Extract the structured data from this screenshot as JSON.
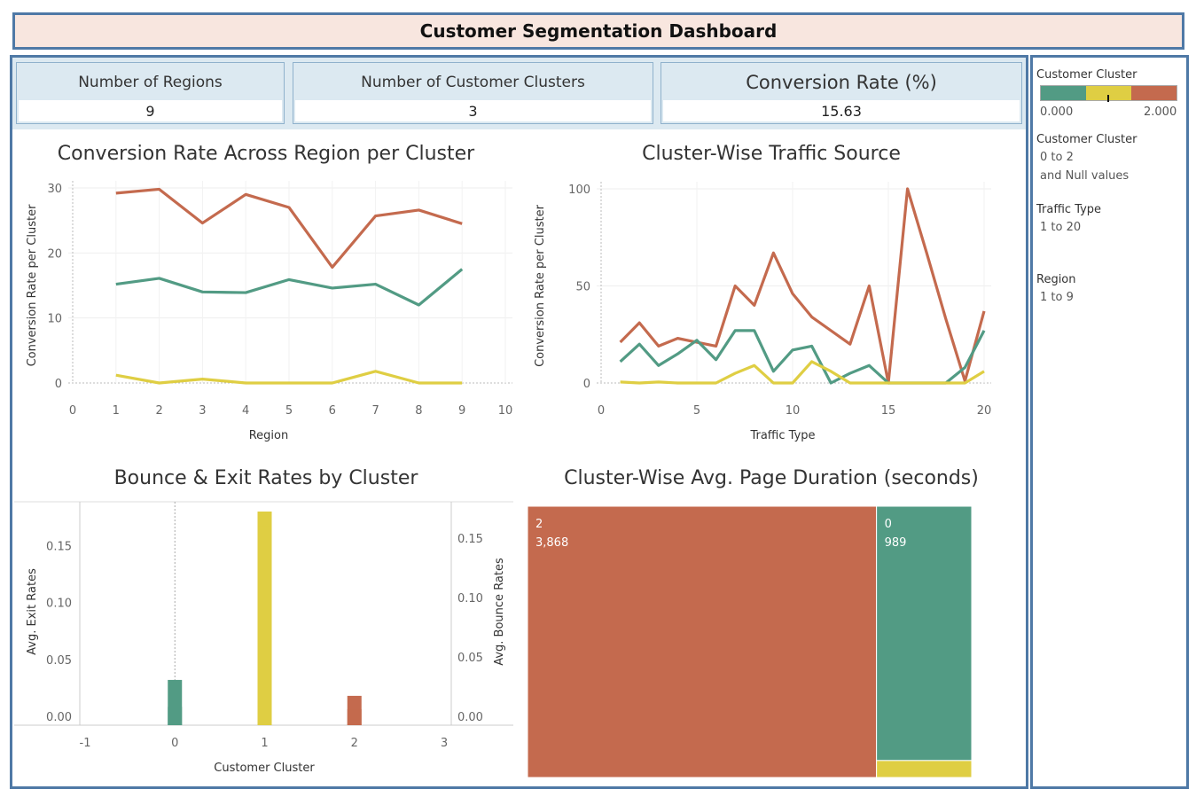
{
  "title": "Customer Segmentation  Dashboard",
  "kpis": [
    {
      "label": "Number of Regions",
      "value": "9"
    },
    {
      "label": "Number of Customer Clusters",
      "value": "3"
    },
    {
      "label": "Conversion Rate (%)",
      "value": "15.63"
    }
  ],
  "colors": {
    "cluster0": "#529b84",
    "cluster1": "#dfce43",
    "cluster2": "#c46a4e"
  },
  "sidebar": {
    "color_legend_title": "Customer Cluster",
    "color_min": "0.000",
    "color_max": "2.000",
    "filters": [
      {
        "title": "Customer Cluster",
        "values": [
          "0 to 2",
          "and Null values"
        ]
      },
      {
        "title": "Traffic Type",
        "values": [
          "1 to 20"
        ]
      },
      {
        "title": "Region",
        "values": [
          "1 to 9"
        ]
      }
    ]
  },
  "chart_data": [
    {
      "type": "line",
      "title": "Conversion Rate Across Region per Cluster",
      "xlabel": "Region",
      "ylabel": "Conversion Rate per Cluster",
      "xlim": [
        0,
        10
      ],
      "ylim": [
        0,
        30
      ],
      "xticks": [
        "0",
        "1",
        "2",
        "3",
        "4",
        "5",
        "6",
        "7",
        "8",
        "9",
        "10"
      ],
      "yticks": [
        "0",
        "10",
        "20",
        "30"
      ],
      "x": [
        1,
        2,
        3,
        4,
        5,
        6,
        7,
        8,
        9
      ],
      "series": [
        {
          "name": "2",
          "values": [
            29.2,
            29.8,
            24.6,
            29.0,
            27.0,
            17.8,
            25.7,
            26.6,
            24.5
          ]
        },
        {
          "name": "0",
          "values": [
            15.2,
            16.1,
            14.0,
            13.9,
            15.9,
            14.6,
            15.2,
            12.0,
            17.5
          ]
        },
        {
          "name": "1",
          "values": [
            1.2,
            0.0,
            0.6,
            0.0,
            0.0,
            0.0,
            1.8,
            0.0,
            0.0
          ]
        }
      ]
    },
    {
      "type": "line",
      "title": "Cluster-Wise Traffic Source",
      "xlabel": "Traffic Type",
      "ylabel": "Conversion Rate per Cluster",
      "xlim": [
        0,
        20
      ],
      "ylim": [
        0,
        100
      ],
      "xticks": [
        "0",
        "5",
        "10",
        "15",
        "20"
      ],
      "yticks": [
        "0",
        "50",
        "100"
      ],
      "x": [
        1,
        2,
        3,
        4,
        5,
        6,
        7,
        8,
        9,
        10,
        11,
        12,
        13,
        14,
        15,
        16,
        17,
        18,
        19,
        20
      ],
      "series": [
        {
          "name": "2",
          "values": [
            21,
            31,
            19,
            23,
            21,
            19,
            50,
            40,
            67,
            46,
            34,
            27,
            20,
            50,
            0,
            100,
            67,
            33,
            1,
            37
          ]
        },
        {
          "name": "0",
          "values": [
            11,
            20,
            9,
            15,
            22,
            12,
            27,
            27,
            6,
            17,
            19,
            0,
            5,
            9,
            0,
            0,
            0,
            0,
            8,
            27
          ]
        },
        {
          "name": "1",
          "values": [
            0.5,
            0,
            0.5,
            0,
            0,
            0,
            5,
            9,
            0,
            0,
            11,
            6,
            0,
            0,
            0,
            0,
            0,
            0,
            0,
            6
          ]
        }
      ]
    },
    {
      "type": "bar",
      "title": "Bounce & Exit Rates by Cluster",
      "xlabel": "Customer Cluster",
      "ylabel": "Avg. Exit Rates",
      "y2label": "Avg. Bounce Rates",
      "xlim": [
        -1,
        3
      ],
      "xticks": [
        "-1",
        "0",
        "1",
        "2",
        "3"
      ],
      "ylim": [
        0,
        0.18
      ],
      "yticks": [
        "0.00",
        "0.05",
        "0.10",
        "0.15"
      ],
      "y2lim": [
        0,
        0.165
      ],
      "y2ticks": [
        "0.00",
        "0.05",
        "0.10",
        "0.15"
      ],
      "categories": [
        "0",
        "1",
        "2"
      ],
      "series": [
        {
          "name": "Avg. Exit Rates",
          "values": [
            0.032,
            0.18,
            0.018
          ]
        },
        {
          "name": "Avg. Bounce Rates",
          "values": [
            0.008,
            0.16,
            0.006
          ]
        }
      ]
    },
    {
      "type": "treemap",
      "title": "Cluster-Wise Avg. Page Duration (seconds)",
      "items": [
        {
          "cluster": "2",
          "label": "3,868",
          "value": 3868
        },
        {
          "cluster": "0",
          "label": "989",
          "value": 989
        },
        {
          "cluster": "1",
          "label": "",
          "value": 66
        }
      ]
    }
  ]
}
